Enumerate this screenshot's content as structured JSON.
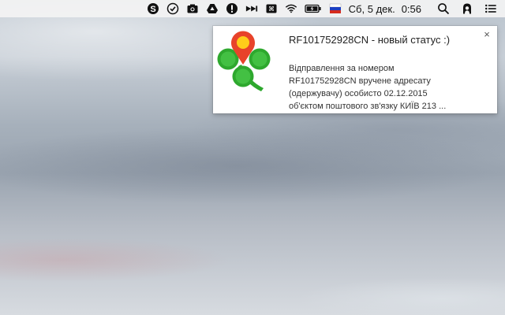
{
  "menubar": {
    "icons": [
      "skype-icon",
      "checkmark-circle-icon",
      "screenshot-camera-icon",
      "google-drive-icon",
      "info-exclamation-icon",
      "fast-forward-arrows-icon",
      "command-key-icon",
      "wifi-icon",
      "battery-charging-icon",
      "russian-flag-icon"
    ],
    "clock_date": "Сб, 5 дек.",
    "clock_time": "0:56",
    "right_icons": [
      "spotlight-search-icon",
      "user-lock-icon",
      "notification-center-icon"
    ]
  },
  "notification": {
    "title": "RF101752928CN - новый статус :)",
    "body": "Відправлення за номером\nRF101752928CN вручене адресату\n(одержувачу) особисто 02.12.2015\nоб'єктом поштового зв'язку КИЇВ 213 ...",
    "close": "×",
    "icon": "green-clover-location-pin-icon"
  },
  "colors": {
    "clover_green": "#2ea82e",
    "pin_red": "#e8432a",
    "pin_yellow": "#ffcc1a"
  }
}
